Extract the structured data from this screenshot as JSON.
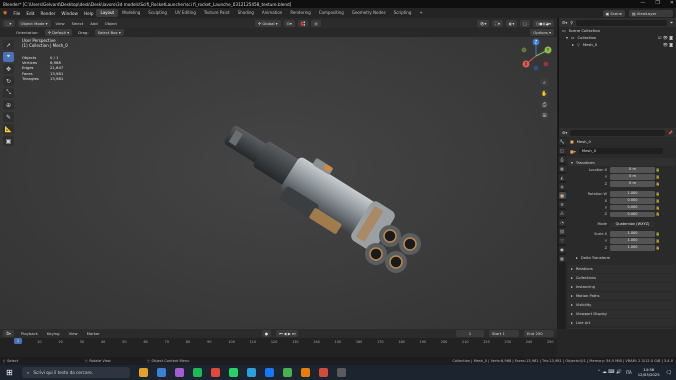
{
  "window": {
    "title": "Blender* [C:\\Users\\Gelvard\\Desktop\\desk\\Desk\\lavoro\\3d models\\Scifi_RocketLauncher\\sci fi_rocket_Launche_0312125458_texture.blend]",
    "controls": [
      "—",
      "❐",
      "✕"
    ]
  },
  "menubar": {
    "menus": [
      "File",
      "Edit",
      "Render",
      "Window",
      "Help"
    ],
    "workspaces": [
      "Layout",
      "Modeling",
      "Sculpting",
      "UV Editing",
      "Texture Paint",
      "Shading",
      "Animation",
      "Rendering",
      "Compositing",
      "Geometry Nodes",
      "Scripting"
    ],
    "active_workspace": "Layout",
    "scene": "Scene",
    "view_layer": "ViewLayer"
  },
  "header3d": {
    "mode": "Object Mode",
    "menus": [
      "View",
      "Select",
      "Add",
      "Object"
    ],
    "transform_orientation": "Global",
    "options": "Options"
  },
  "tool_options": {
    "orientation_label": "Orientation:",
    "orientation_value": "Default",
    "drag_label": "Drag:",
    "drag_value": "Select Box"
  },
  "viewport": {
    "view_name": "User Perspective",
    "collection_line": "(1) Collection | Mesh_0",
    "stats": [
      {
        "k": "Objects",
        "v": "0 / 1"
      },
      {
        "k": "Vertices",
        "v": "6,968"
      },
      {
        "k": "Edges",
        "v": "21,647"
      },
      {
        "k": "Faces",
        "v": "13,981"
      },
      {
        "k": "Triangles",
        "v": "13,981"
      }
    ],
    "gizmo_axes": [
      "Z",
      "Y",
      "X"
    ]
  },
  "outliner": {
    "title": "Scene Collection",
    "rows": [
      {
        "label": "Scene Collection",
        "indent": 0
      },
      {
        "label": "Collection",
        "indent": 1
      },
      {
        "label": "Mesh_0",
        "indent": 2
      }
    ]
  },
  "properties": {
    "crumb": "Mesh_0",
    "object_name": "Mesh_0",
    "transform_title": "Transform",
    "location": {
      "label": "Location X",
      "x": "0 m",
      "y": "0 m",
      "z": "0 m"
    },
    "rotation": {
      "label": "Rotation W",
      "w": "1.000",
      "x": "0.000",
      "y": "0.000",
      "z": "0.000"
    },
    "mode": {
      "label": "Mode",
      "value": "Quaternion (WXYZ)"
    },
    "scale": {
      "label": "Scale X",
      "x": "1.000",
      "y": "1.000",
      "z": "1.000"
    },
    "axis_y": "Y",
    "axis_z": "Z",
    "axis_x": "X",
    "delta": "Delta Transform",
    "sections": [
      "Relations",
      "Collections",
      "Instancing",
      "Motion Paths",
      "Visibility",
      "Viewport Display",
      "Line Art",
      "Custom Properties"
    ]
  },
  "timeline": {
    "menus": [
      "Playback",
      "Keying",
      "View",
      "Marker"
    ],
    "current": "1",
    "start_label": "Start",
    "start": "1",
    "end_label": "End",
    "end": "250",
    "ticks": [
      "0",
      "10",
      "20",
      "30",
      "40",
      "50",
      "60",
      "70",
      "80",
      "90",
      "100",
      "110",
      "120",
      "130",
      "140",
      "150",
      "160",
      "170",
      "180",
      "190",
      "200",
      "210",
      "220",
      "230",
      "240",
      "250"
    ]
  },
  "statusbar": {
    "left": "Select",
    "mid": "Rotate View",
    "mid2": "Object Context Menu",
    "right": "Collection | Mesh_0 | Verts:6,968 | Faces:13,981 | Tris:13,981 | Objects:0/1 | Memory: 54.5 MiB | VRAM: 2.3/12.0 GiB | 3.4.0"
  },
  "taskbar": {
    "search": "Scrivi qui il testo da cercare.",
    "lang": "ITA",
    "time": "14:56",
    "date": "12/03/2025",
    "app_colors": [
      "#e4a12a",
      "#3c7fd6",
      "#a060d0",
      "#1db954",
      "#e04a3a",
      "#25d366",
      "#2aa0dc",
      "#1877f2",
      "#4caf50",
      "#e87d0d",
      "#d14b3b",
      "#5a5a5a"
    ]
  }
}
